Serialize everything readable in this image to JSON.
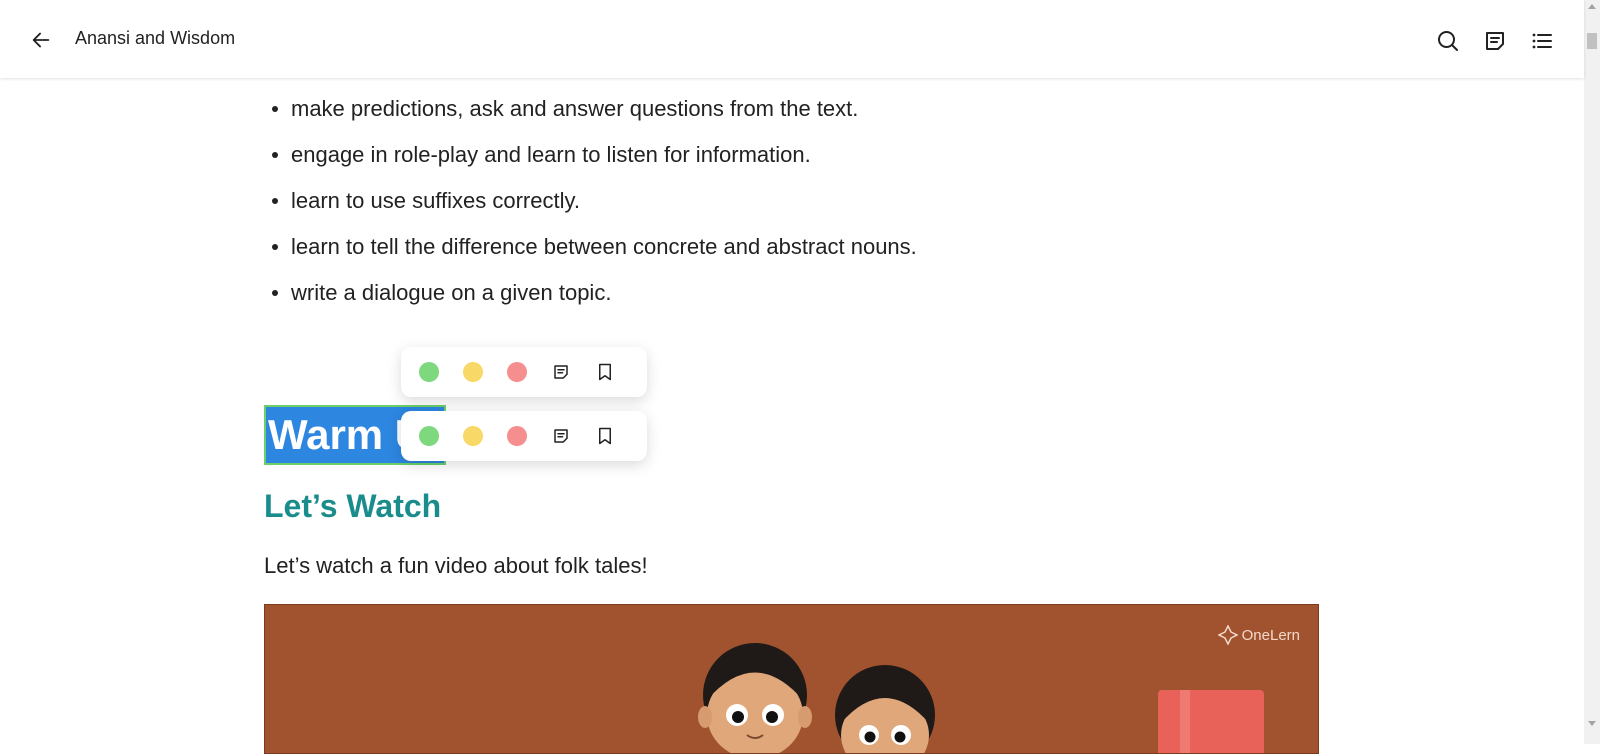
{
  "header": {
    "title": "Anansi and Wisdom",
    "icons": [
      "back-arrow-icon",
      "search-icon",
      "notes-icon",
      "table-of-contents-icon"
    ]
  },
  "objectives": [
    "make predictions, ask and answer questions from the text.",
    "engage in role-play and learn to listen for information.",
    "learn to use suffixes correctly.",
    "learn to tell the difference between concrete and abstract nouns.",
    "write a dialogue on a given topic."
  ],
  "highlight_colors": {
    "green": "#7ed87e",
    "yellow": "#f8d866",
    "red": "#f58e8e"
  },
  "selection": {
    "heading_text": "Warm U",
    "highlight_color": "#2d86e0",
    "border_color": "#6ccf6c"
  },
  "section": {
    "heading": "Let’s Watch",
    "heading_color": "#1a8c8c",
    "description": "Let’s watch a fun video about folk tales!"
  },
  "video": {
    "brand": "OneLern",
    "background": "#a0532e"
  }
}
